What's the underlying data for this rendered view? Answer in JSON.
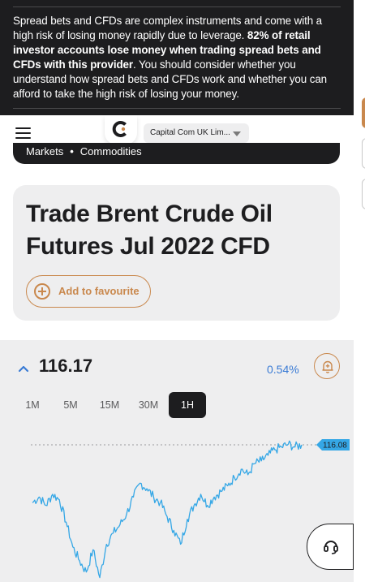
{
  "risk_banner": {
    "text_part1": "Spread bets and CFDs are complex instruments and come with a high risk of losing money rapidly due to leverage. ",
    "text_bold": "82% of retail investor accounts lose money when trading spread bets and CFDs with this provider",
    "text_part2": ". You should consider whether you understand how spread bets and CFDs work and whether you can afford to take the high risk of losing your money."
  },
  "header": {
    "menu_icon": "hamburger-menu-icon",
    "logo_icon": "capital-com-logo-icon",
    "entity_selector": "Capital Com UK Lim..."
  },
  "breadcrumb": {
    "item1": "Markets",
    "separator": "•",
    "item2": "Commodities"
  },
  "title": "Trade Brent Crude Oil Futures Jul 2022 CFD",
  "favourite": {
    "label": "Add to favourite",
    "icon": "plus-circle-icon"
  },
  "quote": {
    "price": "116.17",
    "change": "0.54%",
    "direction_icon": "chevron-up-icon",
    "alert_icon": "bell-plus-icon"
  },
  "timeframes": [
    {
      "label": "1M",
      "active": false
    },
    {
      "label": "5M",
      "active": false
    },
    {
      "label": "15M",
      "active": false
    },
    {
      "label": "30M",
      "active": false
    },
    {
      "label": "1H",
      "active": true
    }
  ],
  "support_icon": "headset-icon",
  "colors": {
    "accent": "#c9884d",
    "dark": "#1d1d1f",
    "panel": "#eeeeef",
    "line": "#35a7e6",
    "change": "#3a7bd5"
  },
  "chart_data": {
    "type": "line",
    "current_price_label": "116.08",
    "ylim": [
      111.2,
      116.4
    ],
    "x": [
      0,
      1,
      2,
      3,
      4,
      5,
      6,
      7,
      8,
      9,
      10,
      11,
      12,
      13,
      14,
      15,
      16,
      17,
      18,
      19,
      20,
      21,
      22,
      23,
      24,
      25,
      26,
      27,
      28,
      29,
      30,
      31,
      32,
      33,
      34,
      35,
      36,
      37,
      38,
      39,
      40
    ],
    "series": [
      {
        "values": [
          114.0,
          114.2,
          113.9,
          114.3,
          114.1,
          113.3,
          112.4,
          111.9,
          111.5,
          112.3,
          111.3,
          112.5,
          112.9,
          113.2,
          113.6,
          114.2,
          114.7,
          114.5,
          114.2,
          114.0,
          113.5,
          113.0,
          112.5,
          113.4,
          113.9,
          114.3,
          113.9,
          114.2,
          114.4,
          114.6,
          114.9,
          115.2,
          115.0,
          115.4,
          115.5,
          115.7,
          115.9,
          116.0,
          116.1,
          116.0,
          116.08
        ]
      }
    ]
  }
}
